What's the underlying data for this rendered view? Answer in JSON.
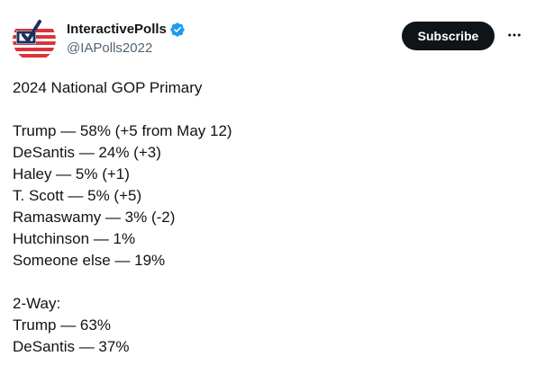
{
  "account": {
    "display_name": "InteractivePolls",
    "handle": "@IAPolls2022",
    "verified_icon": "verified-badge-icon",
    "avatar_icon": "flag-checkmark-logo"
  },
  "actions": {
    "subscribe_label": "Subscribe",
    "more_icon": "more-horizontal-icon"
  },
  "post": {
    "title": "2024 National GOP Primary",
    "results": [
      "Trump — 58% (+5 from May 12)",
      "DeSantis — 24% (+3)",
      "Haley — 5% (+1)",
      "T. Scott — 5% (+5)",
      "Ramaswamy — 3% (-2)",
      "Hutchinson — 1%",
      "Someone else — 19%"
    ],
    "two_way_heading": "2-Way:",
    "two_way": [
      "Trump — 63%",
      "DeSantis — 37%"
    ]
  },
  "colors": {
    "text": "#0f1419",
    "secondary_text": "#536471",
    "verified_blue": "#1d9bf0",
    "button_bg": "#0f1419",
    "flag_red": "#d9343b",
    "flag_navy": "#1f2f5c"
  }
}
